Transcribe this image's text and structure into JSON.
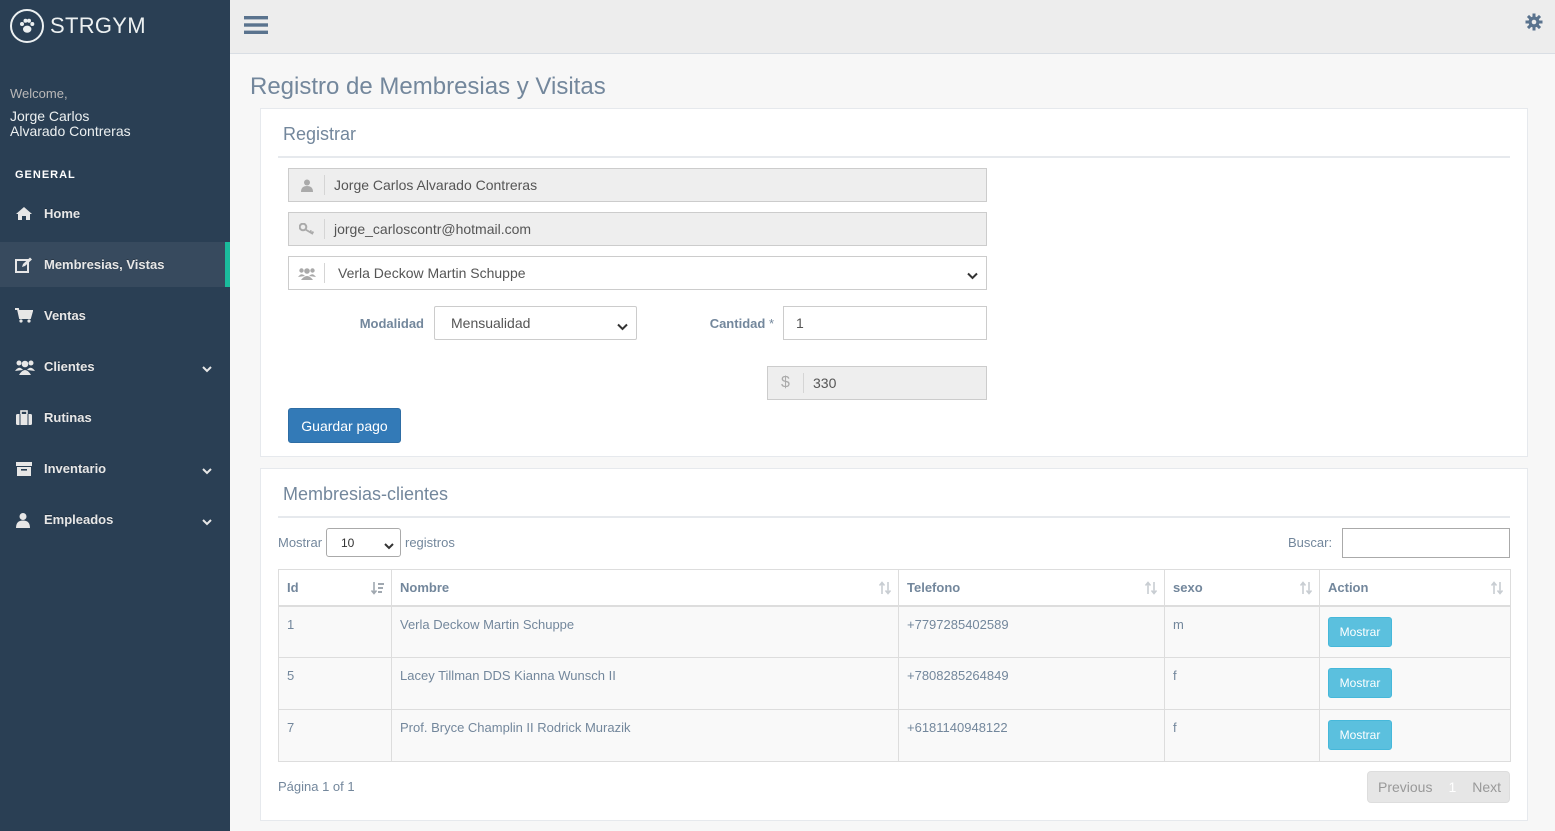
{
  "brand": {
    "title": "STRGYM",
    "logo_icon": "paw-icon"
  },
  "user": {
    "welcome_label": "Welcome,",
    "name_line1": "Jorge Carlos",
    "name_line2": "Alvarado Contreras"
  },
  "sidebar": {
    "section_title": "GENERAL",
    "items": [
      {
        "label": "Home",
        "icon": "home-icon"
      },
      {
        "label": "Membresias, Vistas",
        "icon": "edit-icon"
      },
      {
        "label": "Ventas",
        "icon": "cart-icon"
      },
      {
        "label": "Clientes",
        "icon": "users-icon"
      },
      {
        "label": "Rutinas",
        "icon": "suitcase-icon"
      },
      {
        "label": "Inventario",
        "icon": "archive-icon"
      },
      {
        "label": "Empleados",
        "icon": "user-icon"
      }
    ]
  },
  "page": {
    "title": "Registro de Membresias y Visitas"
  },
  "register": {
    "title": "Registrar",
    "name_value": "Jorge Carlos Alvarado Contreras",
    "email_value": "jorge_carloscontr@hotmail.com",
    "client_selected": "Verla Deckow Martin Schuppe",
    "modalidad_label": "Modalidad",
    "modalidad_selected": "Mensualidad",
    "cantidad_label": "Cantidad",
    "required_mark": "*",
    "currency_symbol": "$",
    "total_value": "330",
    "save_label": "Guardar pago"
  },
  "memberships": {
    "title": "Membresias-clientes",
    "show_label": "Mostrar",
    "page_length": "10",
    "records_label": "registros",
    "search_label": "Buscar:",
    "columns": [
      "Id",
      "Nombre",
      "Telefono",
      "sexo",
      "Action"
    ],
    "rows": [
      {
        "id": "1",
        "nombre": "Verla Deckow Martin Schuppe",
        "telefono": "+7797285402589",
        "sexo": "m",
        "action": "Mostrar"
      },
      {
        "id": "5",
        "nombre": "Lacey Tillman DDS Kianna Wunsch II",
        "telefono": "+7808285264849",
        "sexo": "f",
        "action": "Mostrar"
      },
      {
        "id": "7",
        "nombre": "Prof. Bryce Champlin II Rodrick Murazik",
        "telefono": "+6181140948122",
        "sexo": "f",
        "action": "Mostrar"
      }
    ],
    "page_info": "Página 1 of 1",
    "pager": {
      "previous": "Previous",
      "current": "1",
      "next": "Next"
    }
  },
  "colors": {
    "sidebar_bg": "#2A3F54",
    "accent": "#1ABB9C",
    "primary": "#337AB7",
    "info": "#5BC0DE"
  }
}
